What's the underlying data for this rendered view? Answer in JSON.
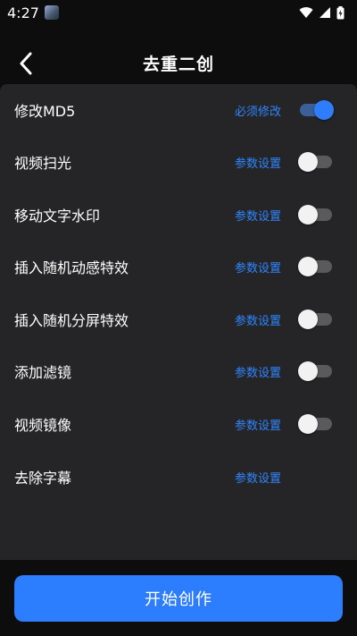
{
  "status": {
    "time": "4:27"
  },
  "header": {
    "title": "去重二创"
  },
  "settings": [
    {
      "label": "修改MD5",
      "link": "必须修改",
      "toggle": true
    },
    {
      "label": "视频扫光",
      "link": "参数设置",
      "toggle": false
    },
    {
      "label": "移动文字水印",
      "link": "参数设置",
      "toggle": false
    },
    {
      "label": "插入随机动感特效",
      "link": "参数设置",
      "toggle": false
    },
    {
      "label": "插入随机分屏特效",
      "link": "参数设置",
      "toggle": false
    },
    {
      "label": "添加滤镜",
      "link": "参数设置",
      "toggle": false
    },
    {
      "label": "视频镜像",
      "link": "参数设置",
      "toggle": false
    },
    {
      "label": "去除字幕",
      "link": "参数设置",
      "toggle": null
    }
  ],
  "action": {
    "start_label": "开始创作"
  },
  "colors": {
    "accent": "#2d7dff",
    "link": "#2f86ff",
    "panel": "#252527",
    "background": "#0d0d0d"
  }
}
